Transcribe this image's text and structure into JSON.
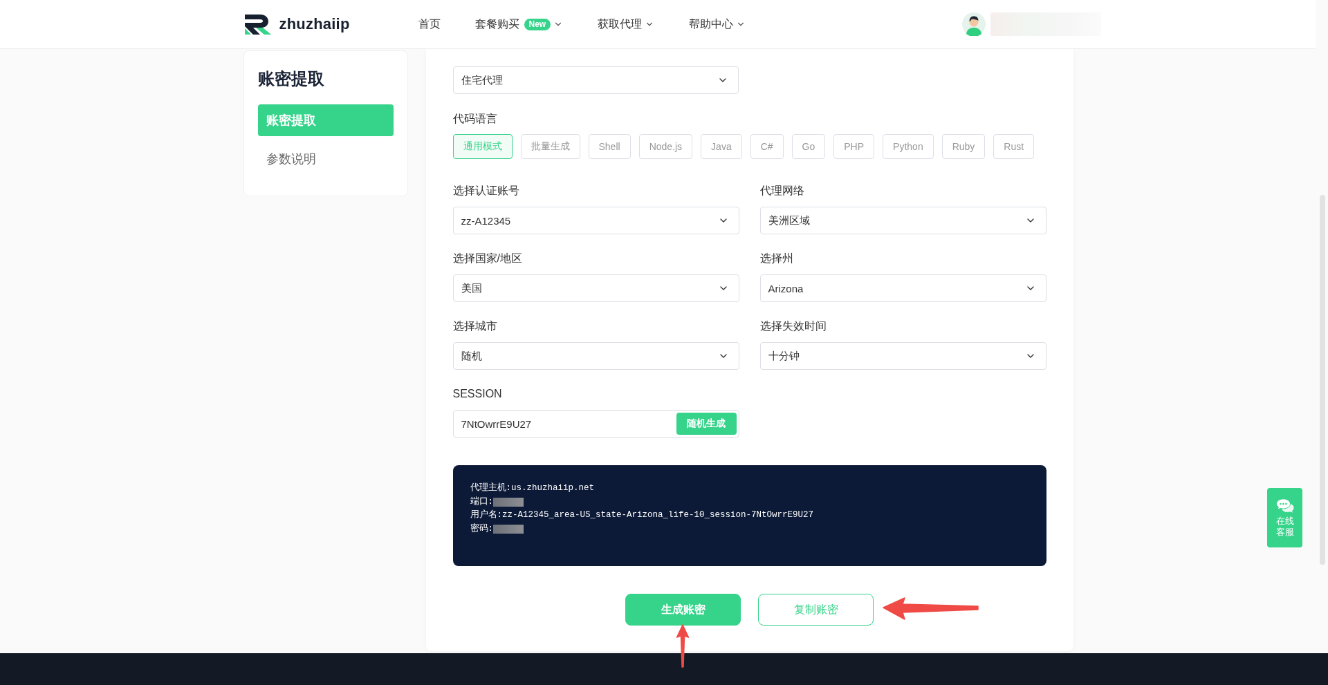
{
  "header": {
    "logo_text": "zhuzhaiip",
    "nav": [
      {
        "label": "首页",
        "dropdown": false
      },
      {
        "label": "套餐购买",
        "badge": "New",
        "dropdown": true
      },
      {
        "label": "获取代理",
        "dropdown": true
      },
      {
        "label": "帮助中心",
        "dropdown": true
      }
    ],
    "user": {
      "name_hidden": true
    }
  },
  "sidebar": {
    "title": "账密提取",
    "items": [
      {
        "label": "账密提取",
        "selected": true
      },
      {
        "label": "参数说明",
        "selected": false
      }
    ]
  },
  "form": {
    "package_select": {
      "value": "住宅代理"
    },
    "code_language": {
      "label": "代码语言",
      "options": [
        {
          "label": "通用模式",
          "selected": true
        },
        {
          "label": "批量生成",
          "selected": false
        },
        {
          "label": "Shell",
          "selected": false
        },
        {
          "label": "Node.js",
          "selected": false
        },
        {
          "label": "Java",
          "selected": false
        },
        {
          "label": "C#",
          "selected": false
        },
        {
          "label": "Go",
          "selected": false
        },
        {
          "label": "PHP",
          "selected": false
        },
        {
          "label": "Python",
          "selected": false
        },
        {
          "label": "Ruby",
          "selected": false
        },
        {
          "label": "Rust",
          "selected": false
        }
      ]
    },
    "fields": [
      {
        "kind": "select",
        "label": "选择认证账号",
        "value": "zz-A12345"
      },
      {
        "kind": "select",
        "label": "代理网络",
        "value": "美洲区域"
      },
      {
        "kind": "select",
        "label": "选择国家/地区",
        "value": "美国"
      },
      {
        "kind": "select",
        "label": "选择州",
        "value": "Arizona"
      },
      {
        "kind": "select",
        "label": "选择城市",
        "value": "随机"
      },
      {
        "kind": "select",
        "label": "选择失效时间",
        "value": "十分钟"
      },
      {
        "kind": "input",
        "label": "SESSION",
        "value": "7NtOwrrE9U27",
        "action": "随机生成"
      }
    ],
    "output": {
      "lines": [
        {
          "text": "代理主机:us.zhuzhaiip.net",
          "redacted": false
        },
        {
          "text": "端口:",
          "redacted": true
        },
        {
          "text": "用户名:zz-A12345_area-US_state-Arizona_life-10_session-7NtOwrrE9U27",
          "redacted": false
        },
        {
          "text": "密码:",
          "redacted": true
        }
      ]
    },
    "buttons": [
      {
        "label": "生成账密",
        "kind": "primary",
        "arrow_below": true,
        "arrow_right": false
      },
      {
        "label": "复制账密",
        "kind": "outline",
        "arrow_below": false,
        "arrow_right": true
      }
    ]
  },
  "support_button": {
    "label": "在线客服"
  }
}
